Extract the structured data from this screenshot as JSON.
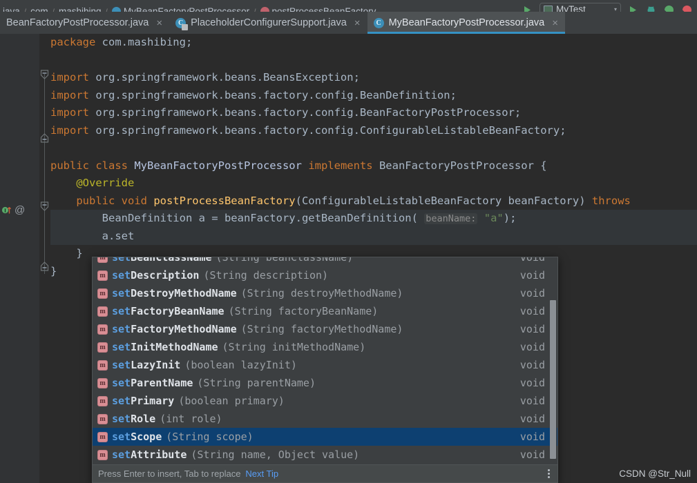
{
  "breadcrumb": {
    "segments": [
      {
        "label": "java",
        "icon": "",
        "color": ""
      },
      {
        "label": "com",
        "icon": "",
        "color": ""
      },
      {
        "label": "mashibing",
        "icon": "",
        "color": ""
      },
      {
        "label": "MyBeanFactoryPostProcessor",
        "icon": "class-icon",
        "color": "#3c8fb8"
      },
      {
        "label": "postProcessBeanFactory",
        "icon": "method-icon",
        "color": "#c0626c"
      }
    ],
    "separator": "/"
  },
  "toolbar": {
    "run_config_name": "MyTest",
    "run_config_caret": "▾",
    "icons": [
      {
        "name": "run-icon",
        "color": "#59a869"
      },
      {
        "name": "debug-icon",
        "color": "#40b6a0"
      },
      {
        "name": "run-with-coverage-icon",
        "color": "#59a869"
      },
      {
        "name": "profile-icon",
        "color": "#db5860"
      }
    ]
  },
  "tabs": [
    {
      "label": "BeanFactoryPostProcessor.java",
      "icon": "",
      "active": false,
      "close": "×"
    },
    {
      "label": "PlaceholderConfigurerSupport.java",
      "icon": "class-icon-semi",
      "active": false,
      "close": "×"
    },
    {
      "label": "MyBeanFactoryPostProcessor.java",
      "icon": "class-icon",
      "active": true,
      "close": "×"
    }
  ],
  "editor": {
    "gutter": {
      "implementing_method_marker": "implementing-method-icon",
      "annotation_marker": "@"
    },
    "lines": [
      {
        "tokens": [
          {
            "t": "package ",
            "c": "k"
          },
          {
            "t": "com.mashibing;",
            "c": "id"
          }
        ]
      },
      {
        "tokens": []
      },
      {
        "tokens": [
          {
            "t": "import ",
            "c": "k"
          },
          {
            "t": "org.springframework.beans.BeansException;",
            "c": "id"
          }
        ]
      },
      {
        "tokens": [
          {
            "t": "import ",
            "c": "k"
          },
          {
            "t": "org.springframework.beans.factory.config.BeanDefinition;",
            "c": "id"
          }
        ]
      },
      {
        "tokens": [
          {
            "t": "import ",
            "c": "k"
          },
          {
            "t": "org.springframework.beans.factory.config.BeanFactoryPostProcessor;",
            "c": "id"
          }
        ]
      },
      {
        "tokens": [
          {
            "t": "import ",
            "c": "k"
          },
          {
            "t": "org.springframework.beans.factory.config.ConfigurableListableBeanFactory;",
            "c": "id"
          }
        ]
      },
      {
        "tokens": []
      },
      {
        "tokens": [
          {
            "t": "public class ",
            "c": "k"
          },
          {
            "t": "MyBeanFactoryPostProcessor",
            "c": "cls"
          },
          {
            "t": " ",
            "c": "id"
          },
          {
            "t": "implements ",
            "c": "k"
          },
          {
            "t": "BeanFactoryPostProcessor {",
            "c": "id"
          }
        ]
      },
      {
        "tokens": [
          {
            "t": "    ",
            "c": "id"
          },
          {
            "t": "@Override",
            "c": "an"
          }
        ]
      },
      {
        "tokens": [
          {
            "t": "    ",
            "c": "id"
          },
          {
            "t": "public void ",
            "c": "k"
          },
          {
            "t": "postProcessBeanFactory",
            "c": "mn"
          },
          {
            "t": "(ConfigurableListableBeanFactory beanFactory) ",
            "c": "id"
          },
          {
            "t": "throws",
            "c": "k"
          }
        ]
      },
      {
        "tokens": [
          {
            "t": "        BeanDefinition a = beanFactory.getBeanDefinition( ",
            "c": "id"
          },
          {
            "t": "beanName:",
            "c": "hint"
          },
          {
            "t": " ",
            "c": "id"
          },
          {
            "t": "\"a\"",
            "c": "st"
          },
          {
            "t": ");",
            "c": "id"
          }
        ],
        "highlight": true
      },
      {
        "tokens": [
          {
            "t": "        a.set",
            "c": "id"
          }
        ],
        "highlight": true
      },
      {
        "tokens": [
          {
            "t": "    }",
            "c": "id"
          }
        ]
      },
      {
        "tokens": [
          {
            "t": "}",
            "c": "id"
          }
        ]
      }
    ]
  },
  "completion": {
    "items": [
      {
        "prefix": "set",
        "rest": "BeanClassName",
        "args": "(String beanClassName)",
        "type": "void",
        "selected": false,
        "clipped": true
      },
      {
        "prefix": "set",
        "rest": "Description",
        "args": "(String description)",
        "type": "void",
        "selected": false
      },
      {
        "prefix": "set",
        "rest": "DestroyMethodName",
        "args": "(String destroyMethodName)",
        "type": "void",
        "selected": false
      },
      {
        "prefix": "set",
        "rest": "FactoryBeanName",
        "args": "(String factoryBeanName)",
        "type": "void",
        "selected": false
      },
      {
        "prefix": "set",
        "rest": "FactoryMethodName",
        "args": "(String factoryMethodName)",
        "type": "void",
        "selected": false
      },
      {
        "prefix": "set",
        "rest": "InitMethodName",
        "args": "(String initMethodName)",
        "type": "void",
        "selected": false
      },
      {
        "prefix": "set",
        "rest": "LazyInit",
        "args": "(boolean lazyInit)",
        "type": "void",
        "selected": false
      },
      {
        "prefix": "set",
        "rest": "ParentName",
        "args": "(String parentName)",
        "type": "void",
        "selected": false
      },
      {
        "prefix": "set",
        "rest": "Primary",
        "args": "(boolean primary)",
        "type": "void",
        "selected": false
      },
      {
        "prefix": "set",
        "rest": "Role",
        "args": "(int role)",
        "type": "void",
        "selected": false
      },
      {
        "prefix": "set",
        "rest": "Scope",
        "args": "(String scope)",
        "type": "void",
        "selected": true
      },
      {
        "prefix": "set",
        "rest": "Attribute",
        "args": "(String name, Object value)",
        "type": "void",
        "selected": false
      }
    ],
    "icon_label": "m",
    "footer": {
      "hint": "Press Enter to insert, Tab to replace",
      "link": "Next Tip",
      "menu": "kebab-menu-icon"
    },
    "selected_bg": "#0d4071",
    "match_color": "#5c9fe0"
  },
  "watermark": "CSDN @Str_Null"
}
